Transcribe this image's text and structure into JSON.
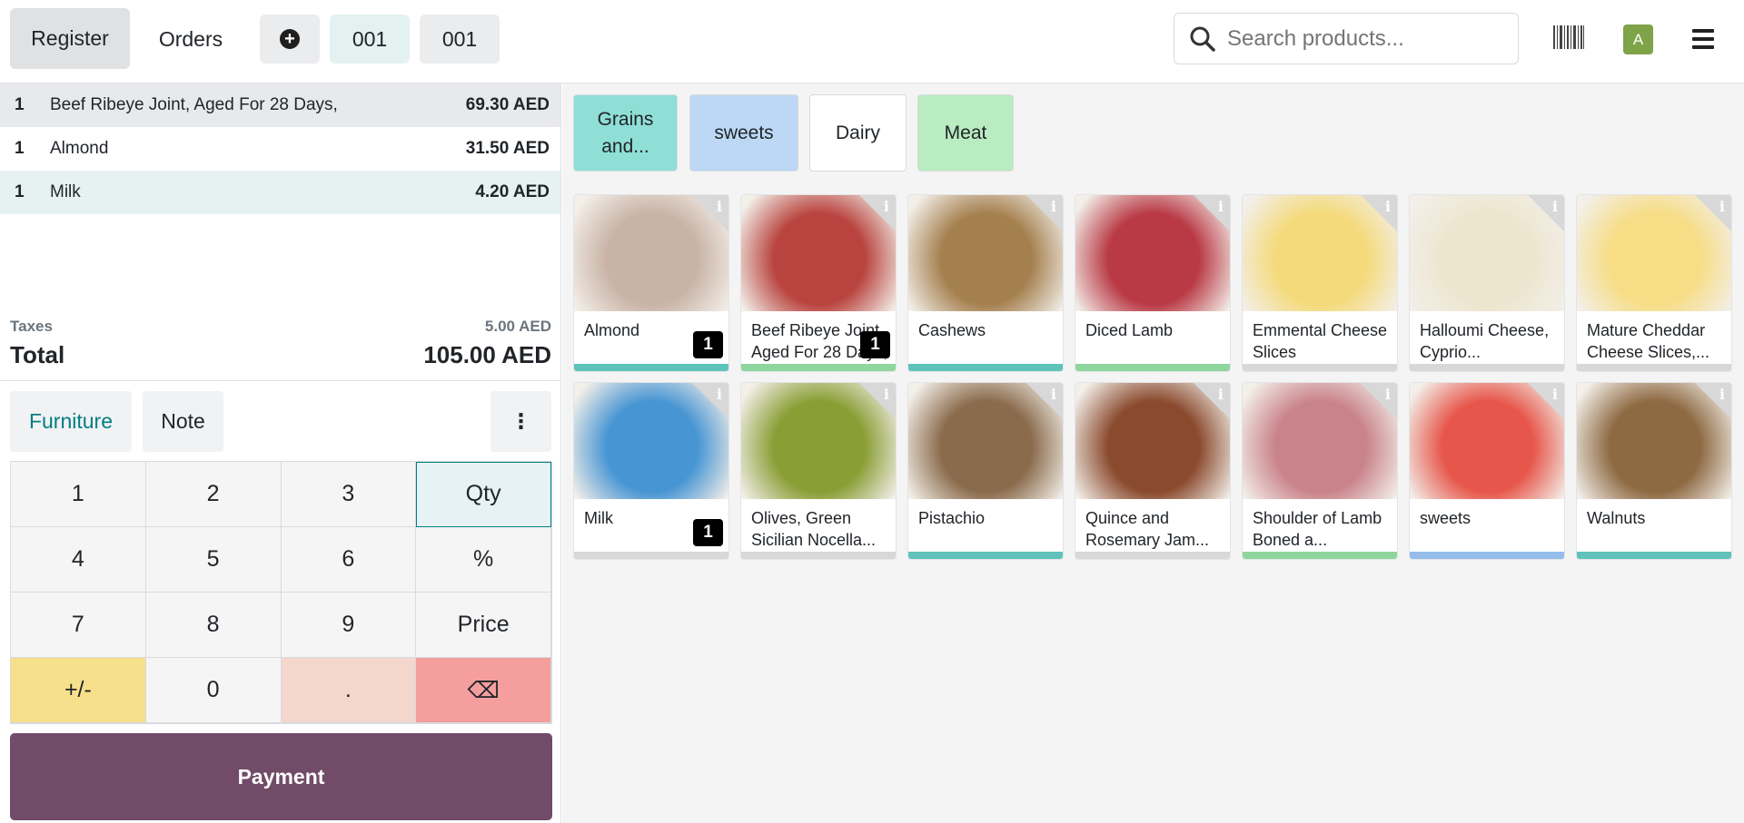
{
  "topbar": {
    "register_label": "Register",
    "orders_label": "Orders",
    "add_icon": "plus-circle-icon",
    "order_tabs": [
      "001",
      "001"
    ],
    "search_placeholder": "Search products...",
    "avatar_letter": "A"
  },
  "order": {
    "lines": [
      {
        "qty": "1",
        "name": "Beef Ribeye Joint, Aged For 28 Days,",
        "price": "69.30 AED"
      },
      {
        "qty": "1",
        "name": "Almond",
        "price": "31.50 AED"
      },
      {
        "qty": "1",
        "name": "Milk",
        "price": "4.20 AED"
      }
    ],
    "taxes_label": "Taxes",
    "taxes_value": "5.00 AED",
    "total_label": "Total",
    "total_value": "105.00 AED"
  },
  "controls": {
    "furniture_label": "Furniture",
    "note_label": "Note",
    "more_label": "⋮"
  },
  "numpad": {
    "keys": [
      "1",
      "2",
      "3",
      "Qty",
      "4",
      "5",
      "6",
      "%",
      "7",
      "8",
      "9",
      "Price",
      "+/-",
      "0",
      ".",
      "⌫"
    ]
  },
  "payment_label": "Payment",
  "categories": [
    {
      "label": "Grains and...",
      "color": "#8fdfd6"
    },
    {
      "label": "sweets",
      "color": "#bcd8f5"
    },
    {
      "label": "Dairy",
      "color": "#ffffff"
    },
    {
      "label": "Meat",
      "color": "#b9ecc0"
    }
  ],
  "products": [
    {
      "name": "Almond",
      "qty": "1",
      "bar": "#5fc3bc",
      "img": "#c9b3a6"
    },
    {
      "name": "Beef Ribeye Joint, Aged For 28 Days,",
      "qty": "1",
      "bar": "#8ed69d",
      "img": "#b9433e"
    },
    {
      "name": "Cashews",
      "qty": "",
      "bar": "#5fc3bc",
      "img": "#a5804f"
    },
    {
      "name": "Diced Lamb",
      "qty": "",
      "bar": "#8ed69d",
      "img": "#b93945"
    },
    {
      "name": "Emmental Cheese Slices",
      "qty": "",
      "bar": "#d8d8d8",
      "img": "#f4da7a"
    },
    {
      "name": "Halloumi Cheese, Cyprio...",
      "qty": "",
      "bar": "#d8d8d8",
      "img": "#ece6cf"
    },
    {
      "name": "Mature Cheddar Cheese Slices,...",
      "qty": "",
      "bar": "#d8d8d8",
      "img": "#f7dd86"
    },
    {
      "name": "Milk",
      "qty": "1",
      "bar": "#d8d8d8",
      "img": "#4795d3"
    },
    {
      "name": "Olives, Green Sicilian Nocella...",
      "qty": "",
      "bar": "#d8d8d8",
      "img": "#8a9e35"
    },
    {
      "name": "Pistachio",
      "qty": "",
      "bar": "#5fc3bc",
      "img": "#8a6b4c"
    },
    {
      "name": "Quince and Rosemary Jam...",
      "qty": "",
      "bar": "#d8d8d8",
      "img": "#8a4a2e"
    },
    {
      "name": "Shoulder of Lamb Boned a...",
      "qty": "",
      "bar": "#8ed69d",
      "img": "#c9838a"
    },
    {
      "name": "sweets",
      "qty": "",
      "bar": "#94bdea",
      "img": "#e7564a"
    },
    {
      "name": "Walnuts",
      "qty": "",
      "bar": "#5fc3bc",
      "img": "#8e6a43"
    }
  ]
}
